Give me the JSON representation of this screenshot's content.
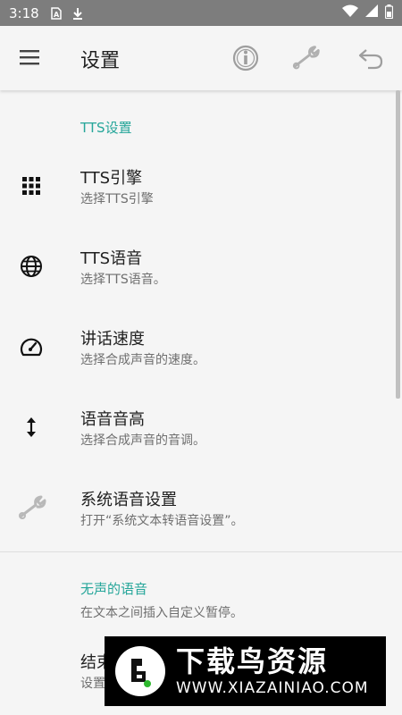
{
  "status_bar": {
    "time": "3:18",
    "left_icons": [
      "sim-card-icon",
      "download-icon"
    ],
    "right_icons": [
      "wifi-icon",
      "signal-icon",
      "battery-icon"
    ]
  },
  "app_bar": {
    "title": "设置",
    "icons": [
      "menu-icon",
      "info-icon",
      "wrench-icon",
      "undo-icon"
    ]
  },
  "sections": [
    {
      "header": "TTS设置",
      "items": [
        {
          "title": "TTS引擎",
          "summary": "选择TTS引擎",
          "icon": "grid-icon"
        },
        {
          "title": "TTS语音",
          "summary": "选择TTS语音。",
          "icon": "globe-icon"
        },
        {
          "title": "讲话速度",
          "summary": "选择合成声音的速度。",
          "icon": "speedometer-icon"
        },
        {
          "title": "语音音高",
          "summary": "选择合成声音的音调。",
          "icon": "vertical-arrows-icon"
        },
        {
          "title": "系统语音设置",
          "summary": "打开“系统文本转语音设置”。",
          "icon": "wrench-icon"
        }
      ]
    },
    {
      "header": "无声的语音",
      "header_summary": "在文本之间插入自定义暂停。",
      "items": [
        {
          "title": "结束",
          "summary": "设置"
        }
      ]
    }
  ],
  "watermark": {
    "title": "下载鸟资源",
    "url": "WWW.XIAZAINIAO.COM"
  },
  "colors": {
    "accent": "#26a69a",
    "status_bar": "#7d7d7d",
    "background": "#f5f5f5",
    "title_text": "#212121",
    "summary_text": "#6f6f6f"
  }
}
